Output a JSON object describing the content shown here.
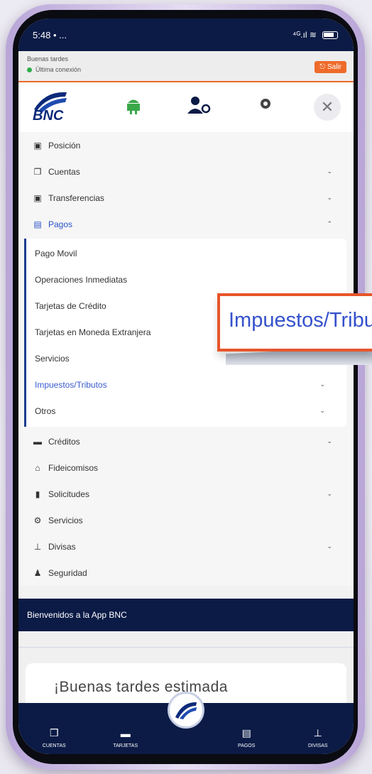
{
  "status_bar": {
    "time": "5:48",
    "dots": "•  ...",
    "signal": "⁴ᴳ.ıl ≋"
  },
  "header": {
    "greeting": "Buenas tardes",
    "last_session": "Última conexión",
    "logout": "Salir"
  },
  "top_icons": {
    "logo_text": "BNC"
  },
  "menu": {
    "items_top": [
      {
        "label": "Posición",
        "icon": "▣",
        "chevron": ""
      },
      {
        "label": "Cuentas",
        "icon": "❒",
        "chevron": "⌄"
      },
      {
        "label": "Transferencias",
        "icon": "▣",
        "chevron": "⌄"
      },
      {
        "label": "Pagos",
        "icon": "▤",
        "chevron": "⌃"
      }
    ],
    "pagos_sub": [
      {
        "label": "Pago Movil",
        "chevron": ""
      },
      {
        "label": "Operaciones Inmediatas",
        "chevron": ""
      },
      {
        "label": "Tarjetas de Crédito",
        "chevron": ""
      },
      {
        "label": "Tarjetas en Moneda Extranjera",
        "chevron": ""
      },
      {
        "label": "Servicios",
        "chevron": ""
      },
      {
        "label": "Impuestos/Tributos",
        "chevron": "⌄"
      },
      {
        "label": "Otros",
        "chevron": "⌄"
      }
    ],
    "items_bottom": [
      {
        "label": "Créditos",
        "icon": "▬",
        "chevron": "⌄"
      },
      {
        "label": "Fideicomisos",
        "icon": "⌂",
        "chevron": ""
      },
      {
        "label": "Solicitudes",
        "icon": "▮",
        "chevron": "⌄"
      },
      {
        "label": "Servicios",
        "icon": "⚙",
        "chevron": ""
      },
      {
        "label": "Divisas",
        "icon": "⊥",
        "chevron": "⌄"
      },
      {
        "label": "Seguridad",
        "icon": "♟",
        "chevron": ""
      }
    ]
  },
  "welcome": "Bienvenidos a la App BNC",
  "card_greeting": "¡Buenas tardes estimada",
  "bottom_nav": [
    {
      "label": "CUENTAS",
      "icon": "❒"
    },
    {
      "label": "TARJETAS",
      "icon": "▬"
    },
    {
      "label": "PAGOS",
      "icon": "▤"
    },
    {
      "label": "DIVISAS",
      "icon": "⊥"
    }
  ],
  "callout": "Impuestos/Tributos"
}
